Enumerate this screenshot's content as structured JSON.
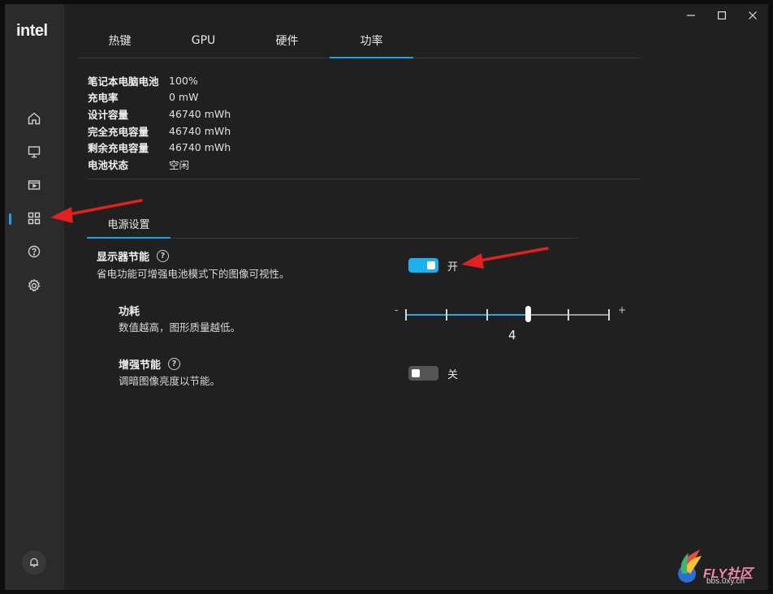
{
  "app": {
    "logo_text": "intel",
    "accent_color": "#1aa3e8"
  },
  "window_controls": {
    "minimize_icon": "minimize-icon",
    "maximize_icon": "maximize-icon",
    "close_icon": "close-icon"
  },
  "sidebar": {
    "items": [
      {
        "icon": "home-icon"
      },
      {
        "icon": "monitor-icon"
      },
      {
        "icon": "video-icon"
      },
      {
        "icon": "grid-apps-icon",
        "active": true
      },
      {
        "icon": "help-circle-icon"
      },
      {
        "icon": "gear-icon"
      }
    ],
    "notification_icon": "bell-icon"
  },
  "tabs": [
    {
      "label": "热键",
      "active": false
    },
    {
      "label": "GPU",
      "active": false
    },
    {
      "label": "硬件",
      "active": false
    },
    {
      "label": "功率",
      "active": true
    }
  ],
  "battery": {
    "rows": [
      {
        "label": "笔记本电脑电池",
        "value": "100%"
      },
      {
        "label": "充电率",
        "value": "0 mW"
      },
      {
        "label": "设计容量",
        "value": "46740 mWh"
      },
      {
        "label": "完全充电容量",
        "value": "46740 mWh"
      },
      {
        "label": "剩余充电容量",
        "value": "46740 mWh"
      },
      {
        "label": "电池状态",
        "value": "空闲"
      }
    ]
  },
  "power_settings": {
    "subtab_label": "电源设置",
    "display_saving": {
      "title": "显示器节能",
      "description": "省电功能可增强电池模式下的图像可视性。",
      "toggle_on": true,
      "toggle_label": "开"
    },
    "power_level": {
      "title": "功耗",
      "description": "数值越高，图形质量越低。",
      "minus_label": "-",
      "plus_label": "+",
      "value": "4",
      "steps": 6,
      "position_step": 3
    },
    "enhanced_saving": {
      "title": "增强节能",
      "description": "调暗图像亮度以节能。",
      "toggle_on": false,
      "toggle_label": "关"
    }
  },
  "watermark": {
    "text": "FLY社区",
    "subtext": "bbs.0xy.cn"
  }
}
